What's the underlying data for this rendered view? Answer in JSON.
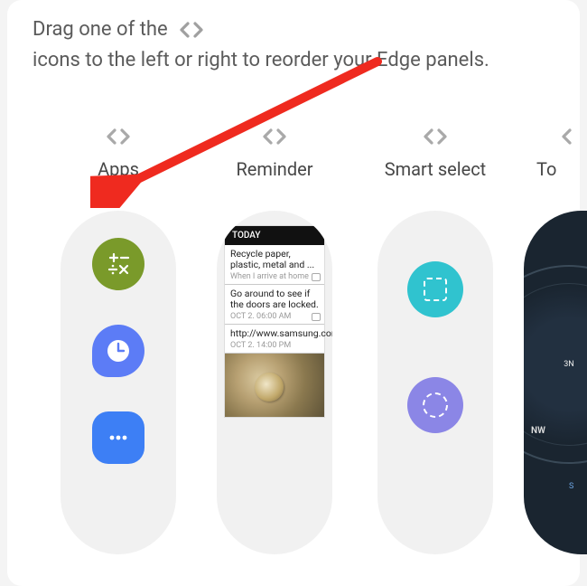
{
  "instruction": {
    "part1": "Drag one of the",
    "part2": "icons to the left or right to reorder your Edge panels."
  },
  "panels": [
    {
      "key": "apps",
      "label": "Apps"
    },
    {
      "key": "reminder",
      "label": "Reminder"
    },
    {
      "key": "smartselect",
      "label": "Smart select"
    },
    {
      "key": "tools",
      "label": "To"
    }
  ],
  "reminder": {
    "header": "TODAY",
    "items": [
      {
        "title": "Recycle paper, plastic, metal and ...",
        "sub": "When I arrive at home"
      },
      {
        "title": "Go around to see if the doors are locked.",
        "sub": "OCT 2. 06:00 AM"
      },
      {
        "title": "http://www.samsung.com",
        "sub": "OCT 2. 14:00 PM"
      }
    ]
  },
  "compass": {
    "nw": "NW",
    "s": "S",
    "center": "3N"
  },
  "colors": {
    "arrow": "#ef2a1f",
    "handle": "#a9a9a9",
    "calc": "#7a9a2a",
    "clock": "#5c7cf6",
    "msg": "#3d7ff5",
    "smart_rect": "#30c3cf",
    "smart_oval": "#8b86e6"
  }
}
